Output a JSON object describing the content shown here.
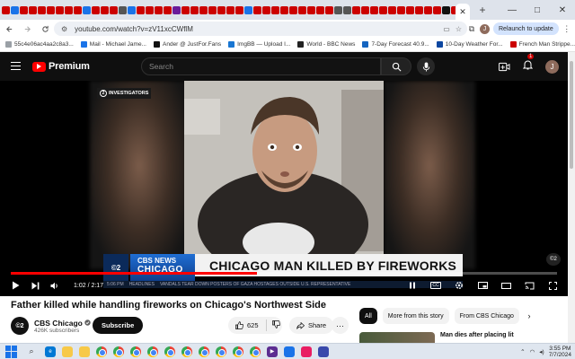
{
  "browser": {
    "active_tab_close": "✕",
    "new_tab": "+",
    "window": {
      "minimize": "—",
      "maximize": "□",
      "close": "✕"
    },
    "url": "youtube.com/watch?v=zV11xcCWflM",
    "relaunch_label": "Relaunch to update",
    "profile_initial": "J",
    "tab_icon_colors": [
      "#cc0000",
      "#1a73e8",
      "#cc0000",
      "#cc0000",
      "#cc0000",
      "#cc0000",
      "#cc0000",
      "#cc0000",
      "#cc0000",
      "#1a73e8",
      "#cc0000",
      "#cc0000",
      "#cc0000",
      "#555",
      "#1a73e8",
      "#cc0000",
      "#cc0000",
      "#cc0000",
      "#cc0000",
      "#6a1b9a",
      "#cc0000",
      "#cc0000",
      "#cc0000",
      "#cc0000",
      "#cc0000",
      "#cc0000",
      "#cc0000",
      "#1a73e8",
      "#cc0000",
      "#cc0000",
      "#cc0000",
      "#cc0000",
      "#cc0000",
      "#cc0000",
      "#cc0000",
      "#cc0000",
      "#cc0000",
      "#555",
      "#555",
      "#cc0000",
      "#cc0000",
      "#cc0000",
      "#cc0000",
      "#cc0000",
      "#cc0000",
      "#cc0000",
      "#cc0000",
      "#cc0000",
      "#cc0000",
      "#111",
      "#cc0000",
      "#cc0000",
      "#111",
      "#cc0000",
      "#cc0000",
      "#555",
      "#f4b400"
    ]
  },
  "bookmarks": [
    {
      "label": "55c4e06ac4aa2c8a3...",
      "color": "#9aa0a6"
    },
    {
      "label": "Mail - Michael Jame...",
      "color": "#1a73e8"
    },
    {
      "label": "Ander @ JustFor.Fans",
      "color": "#111"
    },
    {
      "label": "ImgBB — Upload I...",
      "color": "#1976d2"
    },
    {
      "label": "World - BBC News",
      "color": "#222"
    },
    {
      "label": "7-Day Forecast 40.9...",
      "color": "#1565c0"
    },
    {
      "label": "10-Day Weather For...",
      "color": "#0d47a1"
    },
    {
      "label": "French Man Strippe...",
      "color": "#cc0000"
    }
  ],
  "youtube": {
    "logo_label": "Premium",
    "search_placeholder": "Search",
    "notification_count": "1",
    "avatar_initial": "J"
  },
  "player": {
    "cbs_badge": "INVESTIGATORS",
    "channel_logo_text": "©2",
    "news_label_1": "CBS NEWS",
    "news_label_2": "CHICAGO",
    "headline": "CHICAGO MAN KILLED BY FIREWORKS",
    "ticker_time": "5:06 PM",
    "ticker_section": "HEADLINES",
    "ticker_text": "VANDALS TEAR DOWN POSTERS OF GAZA HOSTAGES OUTSIDE U.S. REPRESENTATIVE",
    "watermark": "©2",
    "time_current": "1:02",
    "time_total": "2:17",
    "progress": 0.45
  },
  "video": {
    "title": "Father killed while handling fireworks on Chicago's Northwest Side",
    "channel_name": "CBS Chicago",
    "channel_avatar": "©2",
    "subscribers": "426K subscribers",
    "subscribe_label": "Subscribe",
    "likes": "625",
    "share_label": "Share",
    "more_label": "···"
  },
  "sidebar": {
    "chips": [
      {
        "label": "All",
        "active": true
      },
      {
        "label": "More from this story",
        "active": false
      },
      {
        "label": "From CBS Chicago",
        "active": false
      }
    ],
    "next_chip": "›",
    "rec_title": "Man dies after placing lit"
  },
  "taskbar": {
    "time": "3:55 PM",
    "date": "7/7/2024"
  }
}
